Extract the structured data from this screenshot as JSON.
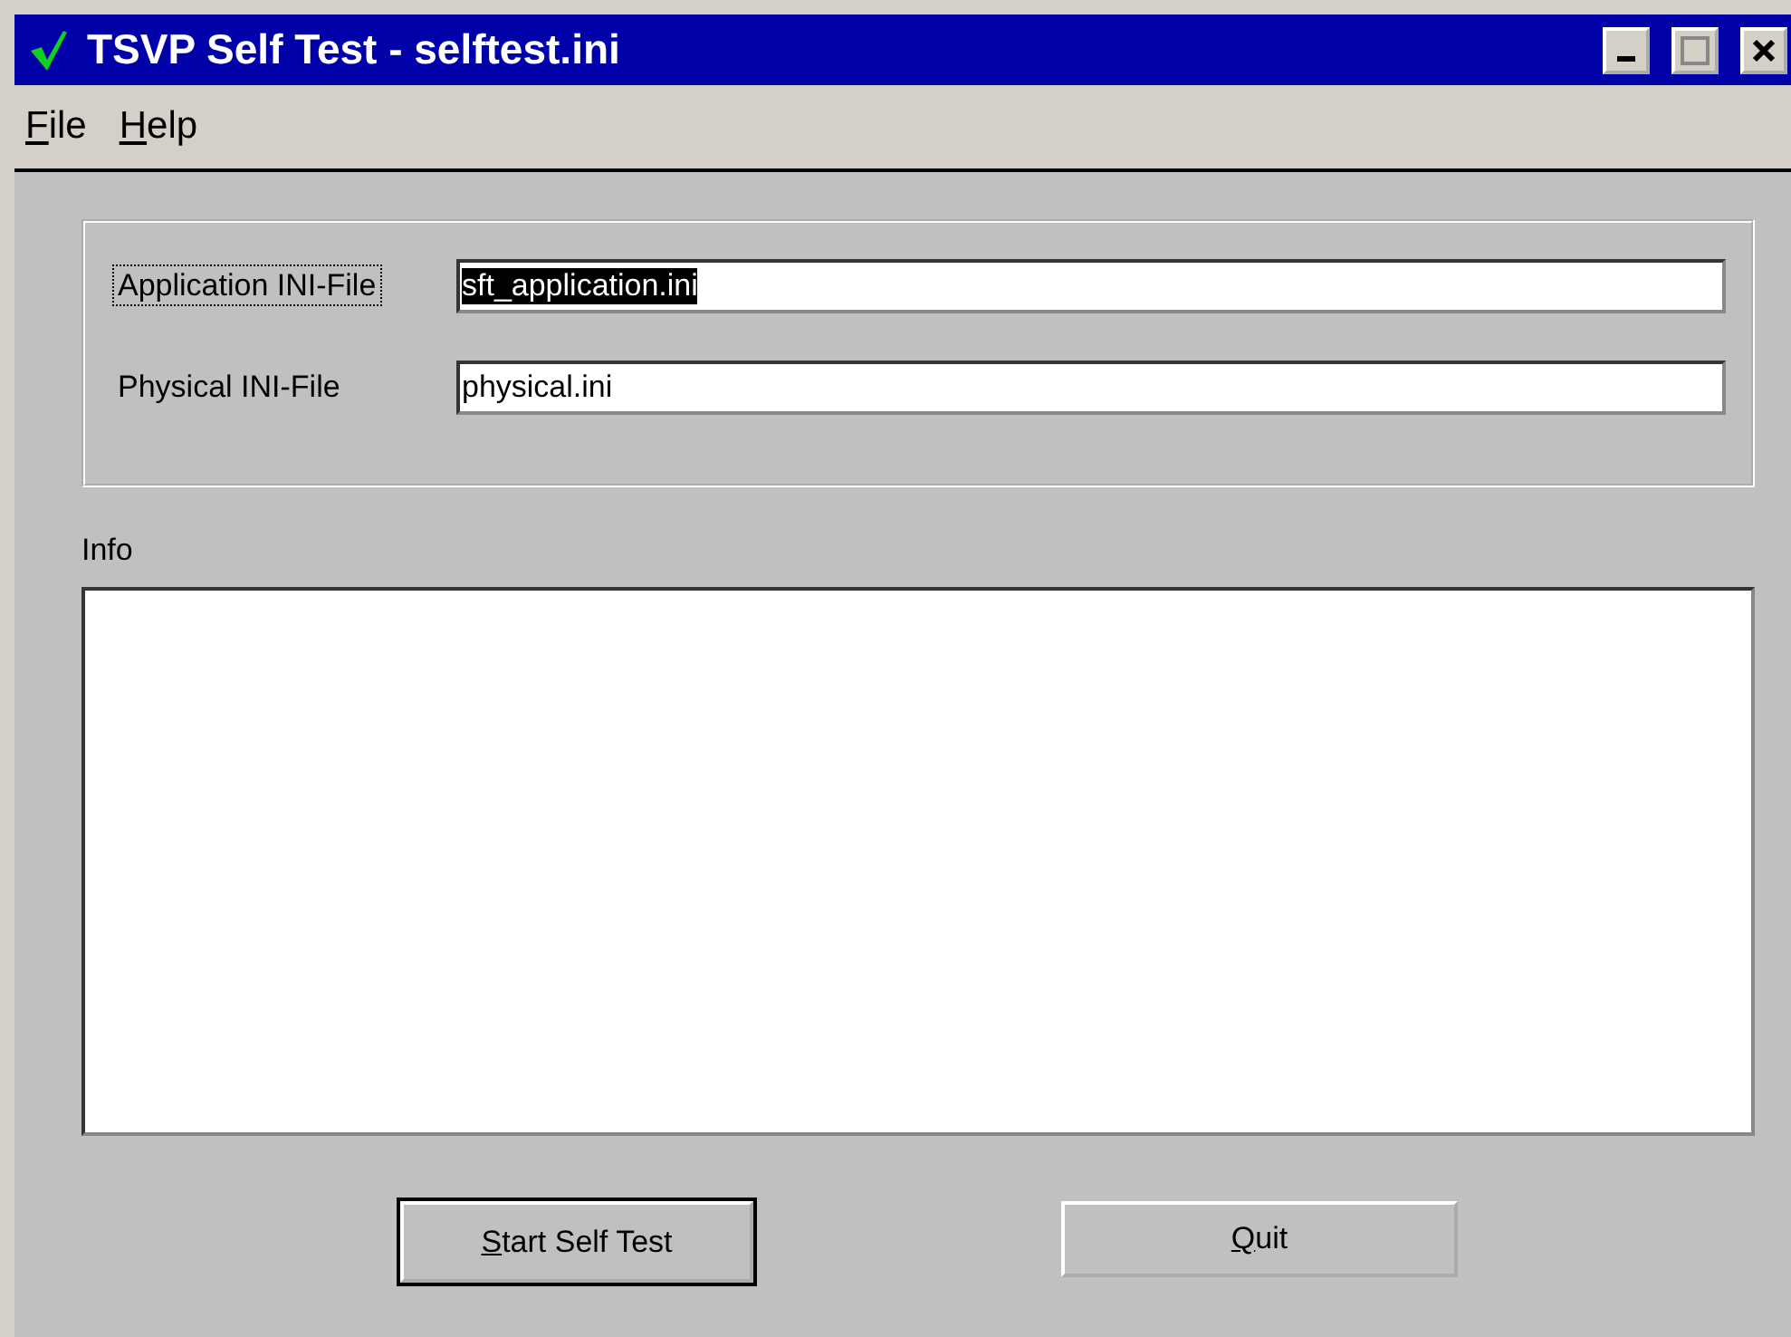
{
  "window": {
    "title": "TSVP Self Test - selftest.ini"
  },
  "menu": [
    {
      "label": "File",
      "mnemonic": true
    },
    {
      "label": "Help",
      "mnemonic": true
    }
  ],
  "fields": [
    {
      "label": "Application INI-File",
      "value": "sft_application.ini",
      "focused": true
    },
    {
      "label": "Physical INI-File",
      "value": "physical.ini",
      "focused": false
    }
  ],
  "info": {
    "label": "Info"
  },
  "buttons": [
    {
      "label": "Start Self Test",
      "mnemonic": true,
      "default": true
    },
    {
      "label": "Quit",
      "mnemonic": true,
      "default": false
    }
  ]
}
